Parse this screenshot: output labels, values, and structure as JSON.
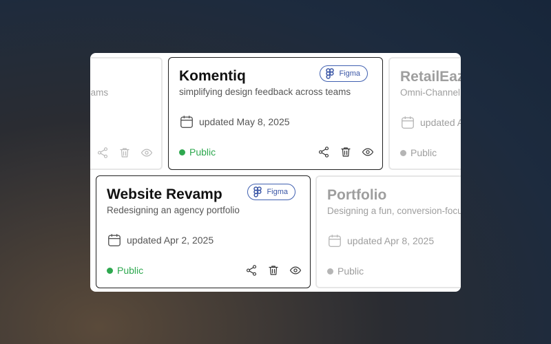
{
  "cards": [
    {
      "title": "",
      "description": "simplifying design feedback across teams",
      "date": "",
      "status": "",
      "style": "faded-partial"
    },
    {
      "title": "Komentiq",
      "description": "simplifying design feedback across teams",
      "date": "updated May 8, 2025",
      "status": "Public",
      "badge": "Figma",
      "style": "active"
    },
    {
      "title": "RetailEaze",
      "description": "Omni-Channel",
      "date": "updated Apr",
      "status": "Public",
      "style": "faded"
    },
    {
      "title": "Website Revamp",
      "description": "Redesigning an agency portfolio",
      "date": "updated Apr 2, 2025",
      "status": "Public",
      "badge": "Figma",
      "style": "active"
    },
    {
      "title": "Portfolio",
      "description": "Designing a fun, conversion-focused",
      "date": "updated Apr 8, 2025",
      "status": "Public",
      "style": "faded"
    }
  ],
  "icons": {
    "calendar": "calendar-icon",
    "share": "share-icon",
    "delete": "trash-icon",
    "view": "eye-icon",
    "figma": "figma-icon"
  },
  "colors": {
    "status_public": "#2ea84f",
    "badge": "#3a56a6"
  }
}
